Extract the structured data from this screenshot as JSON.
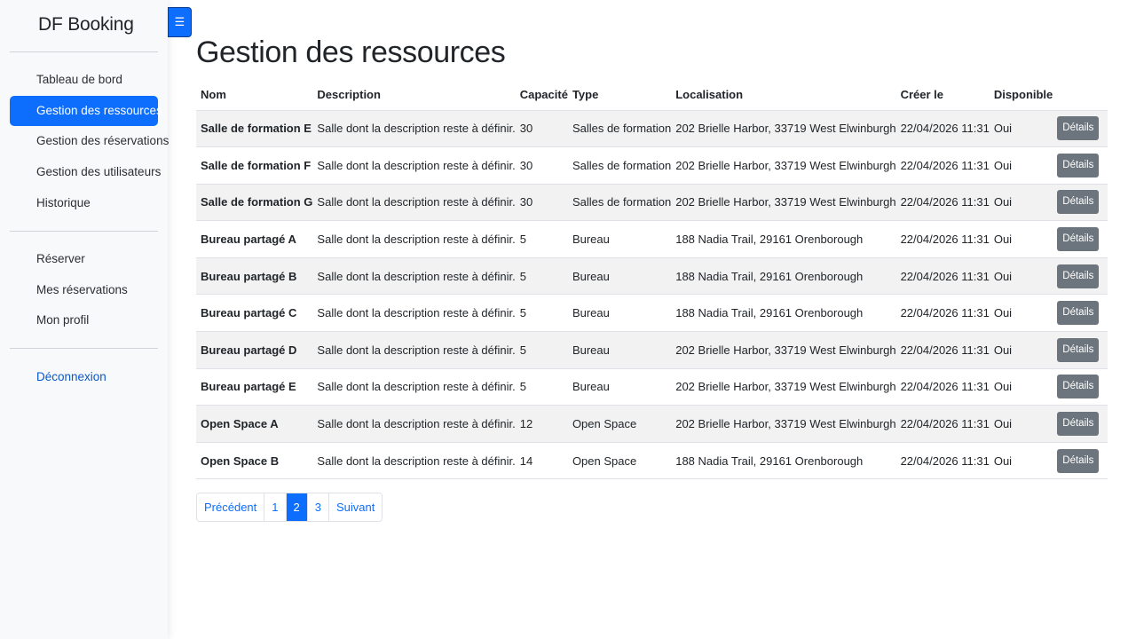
{
  "app": {
    "title": "DF Booking"
  },
  "sidebar": {
    "items": [
      {
        "label": "Tableau de bord"
      },
      {
        "label": "Gestion des ressources"
      },
      {
        "label": "Gestion des réservations"
      },
      {
        "label": "Gestion des utilisateurs"
      },
      {
        "label": "Historique"
      }
    ],
    "items2": [
      {
        "label": "Réserver"
      },
      {
        "label": "Mes réservations"
      },
      {
        "label": "Mon profil"
      }
    ],
    "logout": "Déconnexion",
    "active_index": 1
  },
  "toggle_icon": "☰",
  "main": {
    "title": "Gestion des ressources",
    "columns": [
      "Nom",
      "Description",
      "Capacité",
      "Type",
      "Localisation",
      "Créer le",
      "Disponible"
    ],
    "rows": [
      {
        "name": "Salle de formation E",
        "description": "Salle dont la description reste à définir.",
        "capacity": "30",
        "type": "Salles de formation",
        "location": "202 Brielle Harbor, 33719 West Elwinburgh",
        "created": "22/04/2026 11:31",
        "available": "Oui",
        "action": "Détails"
      },
      {
        "name": "Salle de formation F",
        "description": "Salle dont la description reste à définir.",
        "capacity": "30",
        "type": "Salles de formation",
        "location": "202 Brielle Harbor, 33719 West Elwinburgh",
        "created": "22/04/2026 11:31",
        "available": "Oui",
        "action": "Détails"
      },
      {
        "name": "Salle de formation G",
        "description": "Salle dont la description reste à définir.",
        "capacity": "30",
        "type": "Salles de formation",
        "location": "202 Brielle Harbor, 33719 West Elwinburgh",
        "created": "22/04/2026 11:31",
        "available": "Oui",
        "action": "Détails"
      },
      {
        "name": "Bureau partagé A",
        "description": "Salle dont la description reste à définir.",
        "capacity": "5",
        "type": "Bureau",
        "location": "188 Nadia Trail, 29161 Orenborough",
        "created": "22/04/2026 11:31",
        "available": "Oui",
        "action": "Détails"
      },
      {
        "name": "Bureau partagé B",
        "description": "Salle dont la description reste à définir.",
        "capacity": "5",
        "type": "Bureau",
        "location": "188 Nadia Trail, 29161 Orenborough",
        "created": "22/04/2026 11:31",
        "available": "Oui",
        "action": "Détails"
      },
      {
        "name": "Bureau partagé C",
        "description": "Salle dont la description reste à définir.",
        "capacity": "5",
        "type": "Bureau",
        "location": "188 Nadia Trail, 29161 Orenborough",
        "created": "22/04/2026 11:31",
        "available": "Oui",
        "action": "Détails"
      },
      {
        "name": "Bureau partagé D",
        "description": "Salle dont la description reste à définir.",
        "capacity": "5",
        "type": "Bureau",
        "location": "202 Brielle Harbor, 33719 West Elwinburgh",
        "created": "22/04/2026 11:31",
        "available": "Oui",
        "action": "Détails"
      },
      {
        "name": "Bureau partagé E",
        "description": "Salle dont la description reste à définir.",
        "capacity": "5",
        "type": "Bureau",
        "location": "202 Brielle Harbor, 33719 West Elwinburgh",
        "created": "22/04/2026 11:31",
        "available": "Oui",
        "action": "Détails"
      },
      {
        "name": "Open Space A",
        "description": "Salle dont la description reste à définir.",
        "capacity": "12",
        "type": "Open Space",
        "location": "202 Brielle Harbor, 33719 West Elwinburgh",
        "created": "22/04/2026 11:31",
        "available": "Oui",
        "action": "Détails"
      },
      {
        "name": "Open Space B",
        "description": "Salle dont la description reste à définir.",
        "capacity": "14",
        "type": "Open Space",
        "location": "188 Nadia Trail, 29161 Orenborough",
        "created": "22/04/2026 11:31",
        "available": "Oui",
        "action": "Détails"
      }
    ]
  },
  "pagination": {
    "prev": "Précédent",
    "pages": [
      "1",
      "2",
      "3"
    ],
    "current": "2",
    "next": "Suivant"
  },
  "colors": {
    "accent": "#0d6efd",
    "button_secondary": "#6c757d",
    "stripe": "#f2f2f2"
  }
}
